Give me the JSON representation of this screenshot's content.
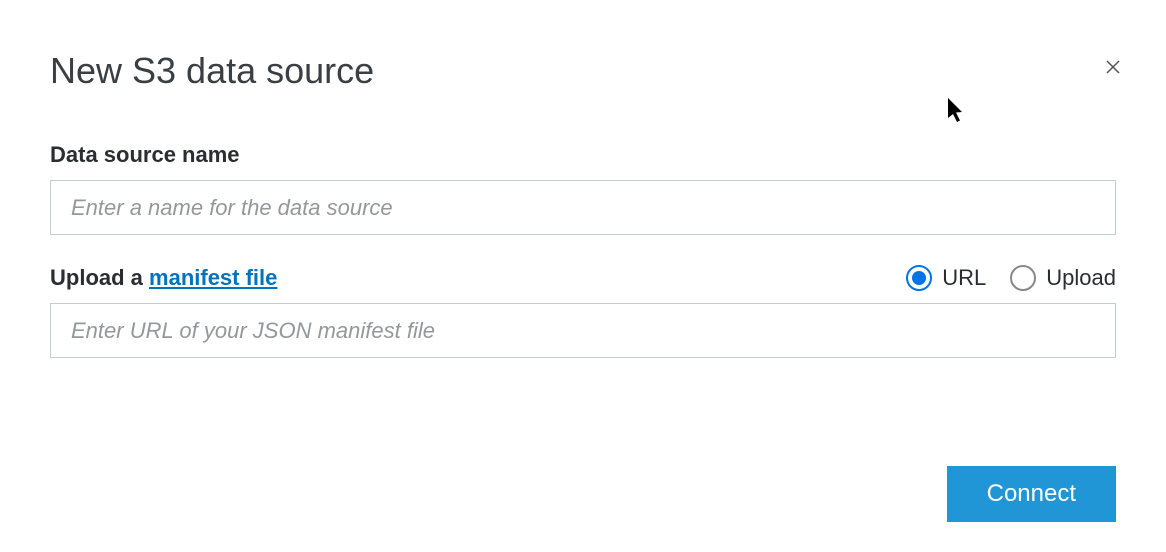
{
  "dialog": {
    "title": "New S3 data source"
  },
  "form": {
    "name_label": "Data source name",
    "name_placeholder": "Enter a name for the data source",
    "upload_label_prefix": "Upload a ",
    "manifest_link_text": "manifest file",
    "manifest_placeholder": "Enter URL of your JSON manifest file"
  },
  "radio": {
    "url_label": "URL",
    "upload_label": "Upload"
  },
  "actions": {
    "connect_label": "Connect"
  }
}
